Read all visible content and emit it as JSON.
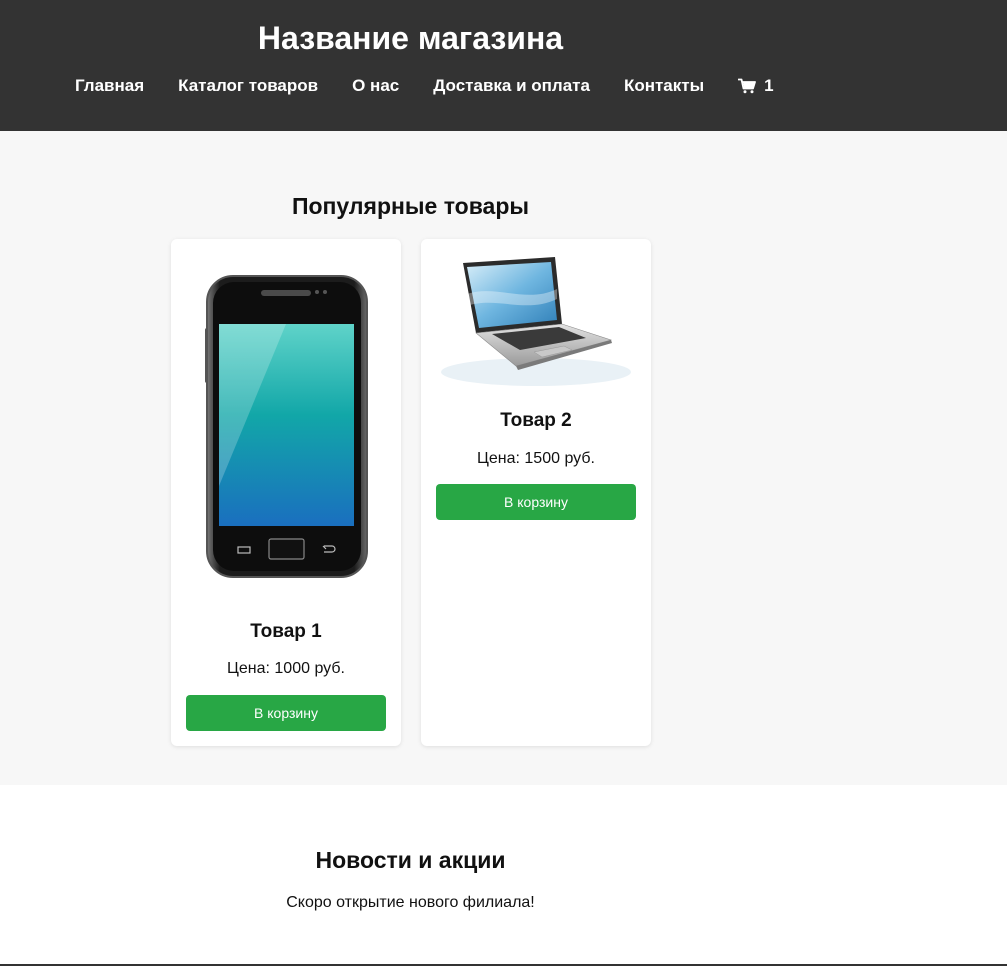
{
  "header": {
    "title": "Название магазина",
    "nav": [
      "Главная",
      "Каталог товаров",
      "О нас",
      "Доставка и оплата",
      "Контакты"
    ],
    "cart_icon": "cart-icon",
    "cart_count": "1"
  },
  "popular": {
    "title": "Популярные товары",
    "products": [
      {
        "name": "Товар 1",
        "price": "Цена: 1000 руб.",
        "button": "В корзину",
        "image": "smartphone-image"
      },
      {
        "name": "Товар 2",
        "price": "Цена: 1500 руб.",
        "button": "В корзину",
        "image": "laptop-image"
      }
    ]
  },
  "news": {
    "title": "Новости и акции",
    "text": "Скоро открытие нового филиала!"
  },
  "colors": {
    "header_bg": "#333333",
    "section_bg": "#f7f7f7",
    "button_bg": "#28a745"
  }
}
